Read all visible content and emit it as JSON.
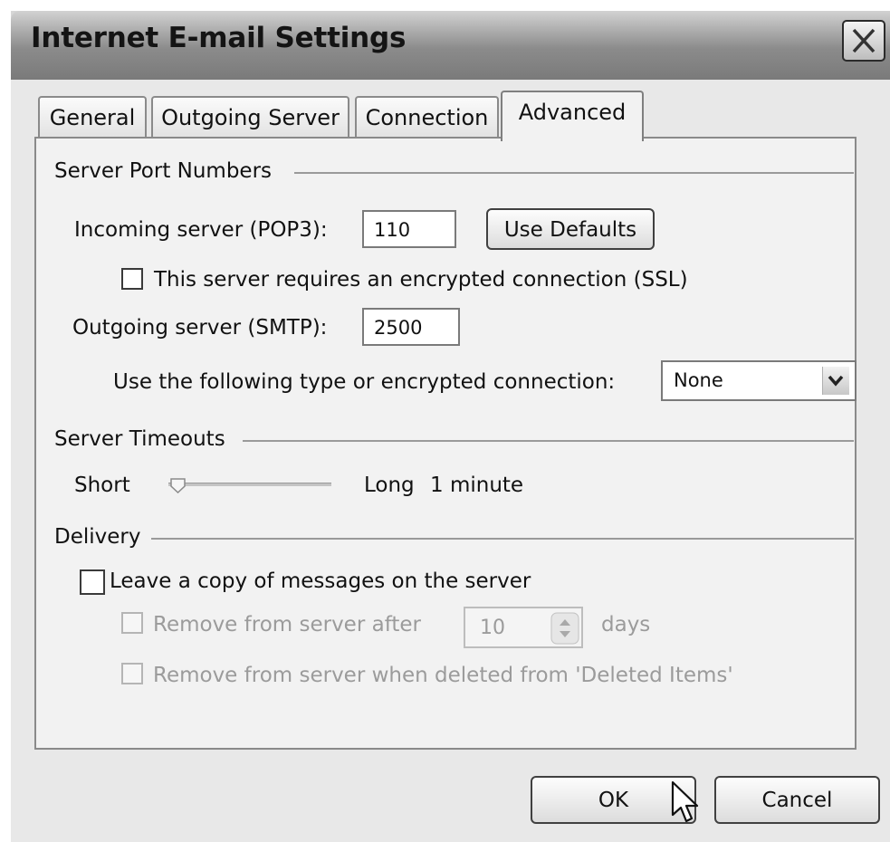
{
  "window": {
    "title": "Internet E-mail Settings"
  },
  "tabs": [
    {
      "label": "General",
      "active": false
    },
    {
      "label": "Outgoing Server",
      "active": false
    },
    {
      "label": "Connection",
      "active": false
    },
    {
      "label": "Advanced",
      "active": true
    }
  ],
  "server_ports": {
    "heading": "Server Port Numbers",
    "incoming_label": "Incoming server (POP3):",
    "incoming_value": "110",
    "use_defaults_label": "Use Defaults",
    "ssl_label": "This server requires an encrypted connection (SSL)",
    "ssl_checked": false,
    "outgoing_label": "Outgoing server (SMTP):",
    "outgoing_value": "2500",
    "encryption_label": "Use the following type or encrypted connection:",
    "encryption_value": "None"
  },
  "timeouts": {
    "heading": "Server Timeouts",
    "short_label": "Short",
    "long_label": "Long",
    "value_label": "1 minute",
    "slider_level": 0.05
  },
  "delivery": {
    "heading": "Delivery",
    "leave_copy_label": "Leave a copy of messages on the server",
    "leave_copy_checked": false,
    "remove_after_label": "Remove from server after",
    "remove_after_value": "10",
    "days_label": "days",
    "remove_deleted_label": "Remove from server when deleted from 'Deleted Items'"
  },
  "footer": {
    "ok_label": "OK",
    "cancel_label": "Cancel"
  },
  "icons": {
    "close": "close-icon",
    "dropdown": "chevron-down-icon",
    "spinner": "spinner-arrows-icon",
    "cursor": "mouse-pointer-icon"
  }
}
